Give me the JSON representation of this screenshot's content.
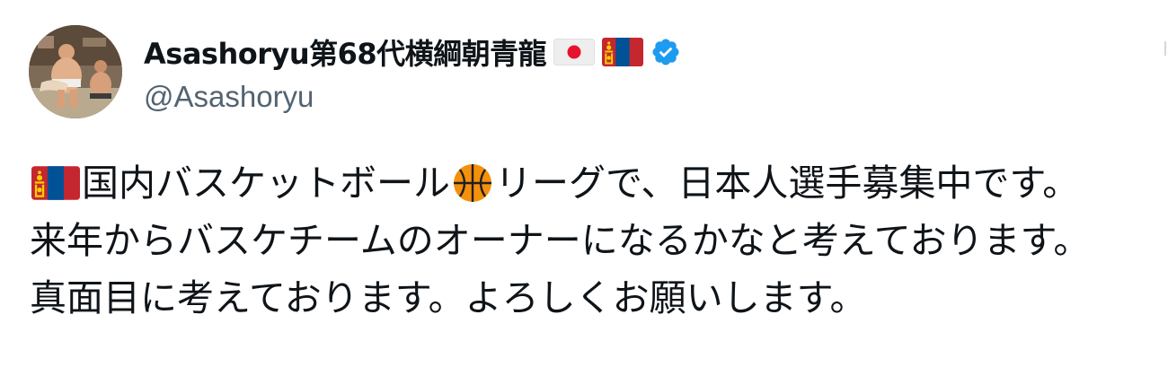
{
  "author": {
    "display_name": "Asashoryu第68代横綱朝青龍",
    "handle": "@Asashoryu",
    "flags": [
      "japan-flag-icon",
      "mongolia-flag-icon"
    ],
    "verified": true,
    "verified_color": "#1d9bf0"
  },
  "tweet": {
    "lines": [
      {
        "lead_icon": "mongolia-flag-icon",
        "part1": "国内バスケットボール",
        "mid_icon": "basketball-icon",
        "part2": "リーグで、日本人選手募集中です。"
      },
      {
        "text": "来年からバスケチームのオーナーになるかなと考えております。"
      },
      {
        "text": "真面目に考えております。よろしくお願いします。"
      }
    ]
  },
  "colors": {
    "text": "#0f1419",
    "secondary": "#536471",
    "japan_red": "#e8112d",
    "mongolia_red": "#c4272f",
    "mongolia_blue": "#015197",
    "soyombo_gold": "#f9cf02",
    "basketball_orange": "#f4900c"
  }
}
